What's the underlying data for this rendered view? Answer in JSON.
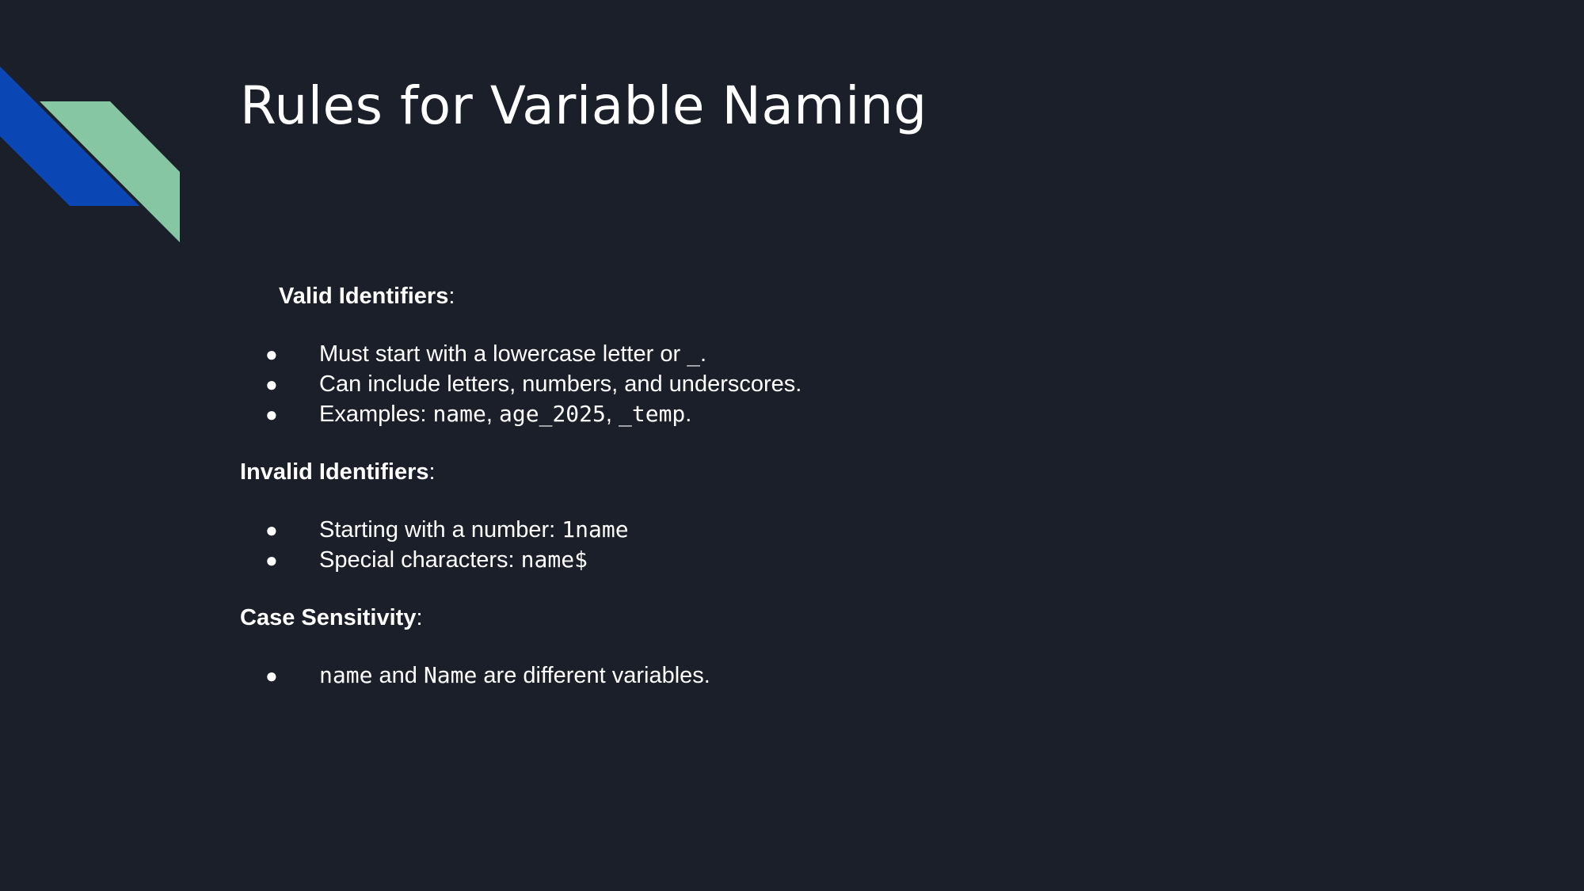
{
  "slide": {
    "title": "Rules for Variable Naming",
    "colors": {
      "background": "#1b1f2a",
      "accent_blue": "#0a47b5",
      "accent_green": "#86c6a2",
      "text": "#ffffff"
    },
    "sections": [
      {
        "heading": "Valid Identifiers",
        "heading_suffix": ":",
        "bullets": [
          {
            "parts": [
              {
                "text": "Must start with a lowercase letter or "
              },
              {
                "code": "_"
              },
              {
                "text": "."
              }
            ]
          },
          {
            "parts": [
              {
                "text": "Can include letters, numbers, and underscores."
              }
            ]
          },
          {
            "parts": [
              {
                "text": "Examples: "
              },
              {
                "code": "name"
              },
              {
                "text": ", "
              },
              {
                "code": "age_2025"
              },
              {
                "text": ", "
              },
              {
                "code": "_temp"
              },
              {
                "text": "."
              }
            ]
          }
        ]
      },
      {
        "heading": "Invalid Identifiers",
        "heading_suffix": ":",
        "bullets": [
          {
            "parts": [
              {
                "text": "Starting with a number: "
              },
              {
                "code": "1name"
              }
            ]
          },
          {
            "parts": [
              {
                "text": "Special characters: "
              },
              {
                "code": "name$"
              }
            ]
          }
        ]
      },
      {
        "heading": "Case Sensitivity",
        "heading_suffix": ":",
        "bullets": [
          {
            "parts": [
              {
                "code": "name"
              },
              {
                "text": " and "
              },
              {
                "code": "Name"
              },
              {
                "text": " are different variables."
              }
            ]
          }
        ]
      }
    ],
    "bullet_glyph": "●"
  }
}
